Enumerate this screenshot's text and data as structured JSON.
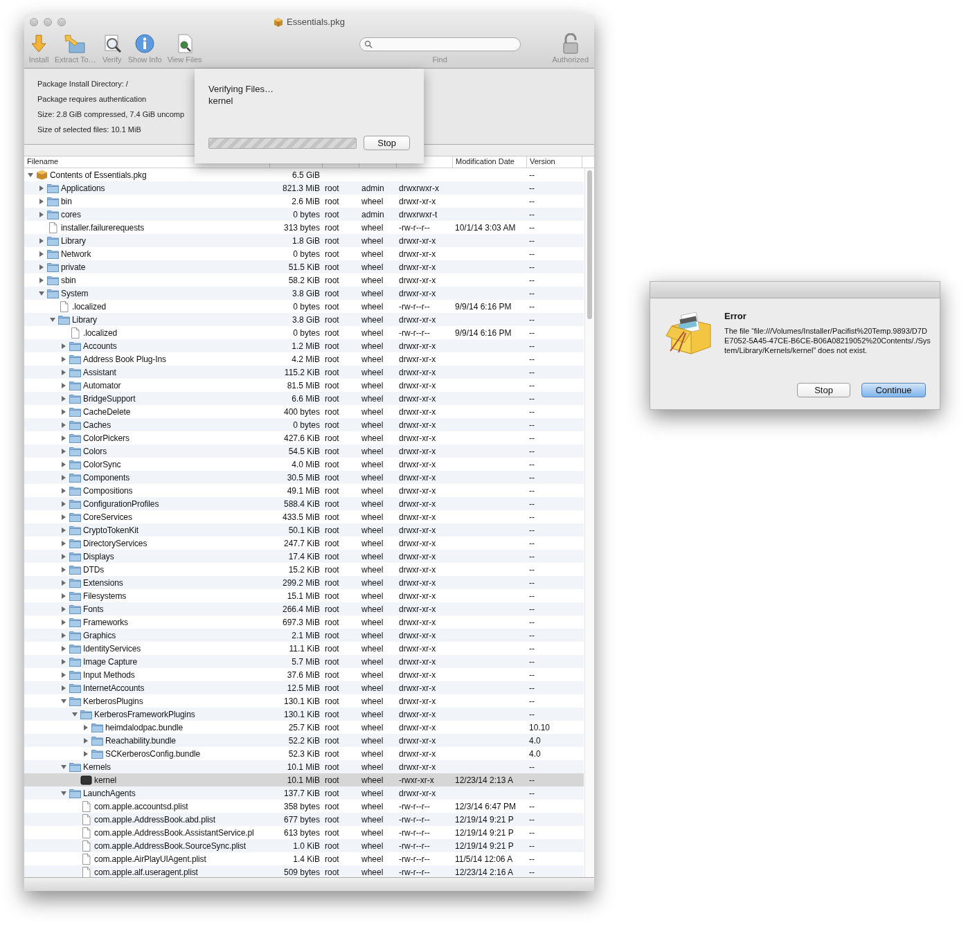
{
  "window": {
    "title": "Essentials.pkg"
  },
  "toolbar": {
    "buttons": [
      {
        "label": "Install",
        "kind": "install"
      },
      {
        "label": "Extract To…",
        "kind": "extract"
      },
      {
        "label": "Verify",
        "kind": "verify"
      },
      {
        "label": "Show Info",
        "kind": "info"
      },
      {
        "label": "View Files",
        "kind": "view-files"
      }
    ],
    "search": {
      "label": "Find"
    },
    "lock": {
      "label": "Authorized"
    }
  },
  "info": [
    "Package Install Directory: /",
    "Package requires authentication",
    "Size: 2.8 GiB compressed, 7.4 GiB uncomp",
    "Size of selected files: 10.1 MiB"
  ],
  "progress_sheet": {
    "title": "Verifying Files…",
    "file": "kernel",
    "button": "Stop",
    "indeterminate": true
  },
  "table": {
    "header": {
      "filename": "Filename",
      "modification_date": "Modification Date",
      "version": "Version"
    },
    "rows": [
      {
        "name": "Contents of Essentials.pkg",
        "kind": "package",
        "size": "6.5 GiB",
        "version": "--",
        "selected": false,
        "expanded": true,
        "children": [
          {
            "name": "Applications",
            "kind": "folder",
            "size": "821.3 MiB",
            "owner": "root",
            "group": "admin",
            "permissions": "drwxrwxr-x",
            "version": "--",
            "selected": false,
            "expanded": false
          },
          {
            "name": "bin",
            "kind": "folder",
            "size": "2.6 MiB",
            "owner": "root",
            "group": "wheel",
            "permissions": "drwxr-xr-x",
            "version": "--",
            "selected": false,
            "expanded": false
          },
          {
            "name": "cores",
            "kind": "folder",
            "size": "0 bytes",
            "owner": "root",
            "group": "admin",
            "permissions": "drwxrwxr-t",
            "version": "--",
            "selected": false,
            "expanded": false
          },
          {
            "name": "installer.failurerequests",
            "kind": "file",
            "size": "313 bytes",
            "owner": "root",
            "group": "wheel",
            "permissions": "-rw-r--r--",
            "modified": "10/1/14 3:03 AM",
            "version": "--",
            "selected": false
          },
          {
            "name": "Library",
            "kind": "folder",
            "size": "1.8 GiB",
            "owner": "root",
            "group": "wheel",
            "permissions": "drwxr-xr-x",
            "version": "--",
            "selected": false,
            "expanded": false
          },
          {
            "name": "Network",
            "kind": "folder",
            "size": "0 bytes",
            "owner": "root",
            "group": "wheel",
            "permissions": "drwxr-xr-x",
            "version": "--",
            "selected": false,
            "expanded": false
          },
          {
            "name": "private",
            "kind": "folder",
            "size": "51.5 KiB",
            "owner": "root",
            "group": "wheel",
            "permissions": "drwxr-xr-x",
            "version": "--",
            "selected": false,
            "expanded": false
          },
          {
            "name": "sbin",
            "kind": "folder",
            "size": "58.2 KiB",
            "owner": "root",
            "group": "wheel",
            "permissions": "drwxr-xr-x",
            "version": "--",
            "selected": false,
            "expanded": false
          },
          {
            "name": "System",
            "kind": "folder",
            "size": "3.8 GiB",
            "owner": "root",
            "group": "wheel",
            "permissions": "drwxr-xr-x",
            "version": "--",
            "selected": false,
            "expanded": true,
            "children": [
              {
                "name": ".localized",
                "kind": "file",
                "size": "0 bytes",
                "owner": "root",
                "group": "wheel",
                "permissions": "-rw-r--r--",
                "modified": "9/9/14 6:16 PM",
                "version": "--",
                "selected": false
              },
              {
                "name": "Library",
                "kind": "folder",
                "size": "3.8 GiB",
                "owner": "root",
                "group": "wheel",
                "permissions": "drwxr-xr-x",
                "version": "--",
                "selected": false,
                "expanded": true,
                "children": [
                  {
                    "name": ".localized",
                    "kind": "file",
                    "size": "0 bytes",
                    "owner": "root",
                    "group": "wheel",
                    "permissions": "-rw-r--r--",
                    "modified": "9/9/14 6:16 PM",
                    "version": "--",
                    "selected": false
                  },
                  {
                    "name": "Accounts",
                    "kind": "folder",
                    "size": "1.2 MiB",
                    "owner": "root",
                    "group": "wheel",
                    "permissions": "drwxr-xr-x",
                    "version": "--",
                    "selected": false,
                    "expanded": false
                  },
                  {
                    "name": "Address Book Plug-Ins",
                    "kind": "folder",
                    "size": "4.2 MiB",
                    "owner": "root",
                    "group": "wheel",
                    "permissions": "drwxr-xr-x",
                    "version": "--",
                    "selected": false,
                    "expanded": false
                  },
                  {
                    "name": "Assistant",
                    "kind": "folder",
                    "size": "115.2 KiB",
                    "owner": "root",
                    "group": "wheel",
                    "permissions": "drwxr-xr-x",
                    "version": "--",
                    "selected": false,
                    "expanded": false
                  },
                  {
                    "name": "Automator",
                    "kind": "folder",
                    "size": "81.5 MiB",
                    "owner": "root",
                    "group": "wheel",
                    "permissions": "drwxr-xr-x",
                    "version": "--",
                    "selected": false,
                    "expanded": false
                  },
                  {
                    "name": "BridgeSupport",
                    "kind": "folder",
                    "size": "6.6 MiB",
                    "owner": "root",
                    "group": "wheel",
                    "permissions": "drwxr-xr-x",
                    "version": "--",
                    "selected": false,
                    "expanded": false
                  },
                  {
                    "name": "CacheDelete",
                    "kind": "folder",
                    "size": "400 bytes",
                    "owner": "root",
                    "group": "wheel",
                    "permissions": "drwxr-xr-x",
                    "version": "--",
                    "selected": false,
                    "expanded": false
                  },
                  {
                    "name": "Caches",
                    "kind": "folder",
                    "size": "0 bytes",
                    "owner": "root",
                    "group": "wheel",
                    "permissions": "drwxr-xr-x",
                    "version": "--",
                    "selected": false,
                    "expanded": false
                  },
                  {
                    "name": "ColorPickers",
                    "kind": "folder",
                    "size": "427.6 KiB",
                    "owner": "root",
                    "group": "wheel",
                    "permissions": "drwxr-xr-x",
                    "version": "--",
                    "selected": false,
                    "expanded": false
                  },
                  {
                    "name": "Colors",
                    "kind": "folder",
                    "size": "54.5 KiB",
                    "owner": "root",
                    "group": "wheel",
                    "permissions": "drwxr-xr-x",
                    "version": "--",
                    "selected": false,
                    "expanded": false
                  },
                  {
                    "name": "ColorSync",
                    "kind": "folder",
                    "size": "4.0 MiB",
                    "owner": "root",
                    "group": "wheel",
                    "permissions": "drwxr-xr-x",
                    "version": "--",
                    "selected": false,
                    "expanded": false
                  },
                  {
                    "name": "Components",
                    "kind": "folder",
                    "size": "30.5 MiB",
                    "owner": "root",
                    "group": "wheel",
                    "permissions": "drwxr-xr-x",
                    "version": "--",
                    "selected": false,
                    "expanded": false
                  },
                  {
                    "name": "Compositions",
                    "kind": "folder",
                    "size": "49.1 MiB",
                    "owner": "root",
                    "group": "wheel",
                    "permissions": "drwxr-xr-x",
                    "version": "--",
                    "selected": false,
                    "expanded": false
                  },
                  {
                    "name": "ConfigurationProfiles",
                    "kind": "folder",
                    "size": "588.4 KiB",
                    "owner": "root",
                    "group": "wheel",
                    "permissions": "drwxr-xr-x",
                    "version": "--",
                    "selected": false,
                    "expanded": false
                  },
                  {
                    "name": "CoreServices",
                    "kind": "folder",
                    "size": "433.5 MiB",
                    "owner": "root",
                    "group": "wheel",
                    "permissions": "drwxr-xr-x",
                    "version": "--",
                    "selected": false,
                    "expanded": false
                  },
                  {
                    "name": "CryptoTokenKit",
                    "kind": "folder",
                    "size": "50.1 KiB",
                    "owner": "root",
                    "group": "wheel",
                    "permissions": "drwxr-xr-x",
                    "version": "--",
                    "selected": false,
                    "expanded": false
                  },
                  {
                    "name": "DirectoryServices",
                    "kind": "folder",
                    "size": "247.7 KiB",
                    "owner": "root",
                    "group": "wheel",
                    "permissions": "drwxr-xr-x",
                    "version": "--",
                    "selected": false,
                    "expanded": false
                  },
                  {
                    "name": "Displays",
                    "kind": "folder",
                    "size": "17.4 KiB",
                    "owner": "root",
                    "group": "wheel",
                    "permissions": "drwxr-xr-x",
                    "version": "--",
                    "selected": false,
                    "expanded": false
                  },
                  {
                    "name": "DTDs",
                    "kind": "folder",
                    "size": "15.2 KiB",
                    "owner": "root",
                    "group": "wheel",
                    "permissions": "drwxr-xr-x",
                    "version": "--",
                    "selected": false,
                    "expanded": false
                  },
                  {
                    "name": "Extensions",
                    "kind": "folder",
                    "size": "299.2 MiB",
                    "owner": "root",
                    "group": "wheel",
                    "permissions": "drwxr-xr-x",
                    "version": "--",
                    "selected": false,
                    "expanded": false
                  },
                  {
                    "name": "Filesystems",
                    "kind": "folder",
                    "size": "15.1 MiB",
                    "owner": "root",
                    "group": "wheel",
                    "permissions": "drwxr-xr-x",
                    "version": "--",
                    "selected": false,
                    "expanded": false
                  },
                  {
                    "name": "Fonts",
                    "kind": "folder",
                    "size": "266.4 MiB",
                    "owner": "root",
                    "group": "wheel",
                    "permissions": "drwxr-xr-x",
                    "version": "--",
                    "selected": false,
                    "expanded": false
                  },
                  {
                    "name": "Frameworks",
                    "kind": "folder",
                    "size": "697.3 MiB",
                    "owner": "root",
                    "group": "wheel",
                    "permissions": "drwxr-xr-x",
                    "version": "--",
                    "selected": false,
                    "expanded": false
                  },
                  {
                    "name": "Graphics",
                    "kind": "folder",
                    "size": "2.1 MiB",
                    "owner": "root",
                    "group": "wheel",
                    "permissions": "drwxr-xr-x",
                    "version": "--",
                    "selected": false,
                    "expanded": false
                  },
                  {
                    "name": "IdentityServices",
                    "kind": "folder",
                    "size": "11.1 KiB",
                    "owner": "root",
                    "group": "wheel",
                    "permissions": "drwxr-xr-x",
                    "version": "--",
                    "selected": false,
                    "expanded": false
                  },
                  {
                    "name": "Image Capture",
                    "kind": "folder",
                    "size": "5.7 MiB",
                    "owner": "root",
                    "group": "wheel",
                    "permissions": "drwxr-xr-x",
                    "version": "--",
                    "selected": false,
                    "expanded": false
                  },
                  {
                    "name": "Input Methods",
                    "kind": "folder",
                    "size": "37.6 MiB",
                    "owner": "root",
                    "group": "wheel",
                    "permissions": "drwxr-xr-x",
                    "version": "--",
                    "selected": false,
                    "expanded": false
                  },
                  {
                    "name": "InternetAccounts",
                    "kind": "folder",
                    "size": "12.5 MiB",
                    "owner": "root",
                    "group": "wheel",
                    "permissions": "drwxr-xr-x",
                    "version": "--",
                    "selected": false,
                    "expanded": false
                  },
                  {
                    "name": "KerberosPlugins",
                    "kind": "folder",
                    "size": "130.1 KiB",
                    "owner": "root",
                    "group": "wheel",
                    "permissions": "drwxr-xr-x",
                    "version": "--",
                    "selected": false,
                    "expanded": true,
                    "children": [
                      {
                        "name": "KerberosFrameworkPlugins",
                        "kind": "folder",
                        "size": "130.1 KiB",
                        "owner": "root",
                        "group": "wheel",
                        "permissions": "drwxr-xr-x",
                        "version": "--",
                        "selected": false,
                        "expanded": true,
                        "children": [
                          {
                            "name": "heimdalodpac.bundle",
                            "kind": "folder",
                            "size": "25.7 KiB",
                            "owner": "root",
                            "group": "wheel",
                            "permissions": "drwxr-xr-x",
                            "version": "10.10",
                            "selected": false,
                            "expanded": false
                          },
                          {
                            "name": "Reachability.bundle",
                            "kind": "folder",
                            "size": "52.2 KiB",
                            "owner": "root",
                            "group": "wheel",
                            "permissions": "drwxr-xr-x",
                            "version": "4.0",
                            "selected": false,
                            "expanded": false
                          },
                          {
                            "name": "SCKerberosConfig.bundle",
                            "kind": "folder",
                            "size": "52.3 KiB",
                            "owner": "root",
                            "group": "wheel",
                            "permissions": "drwxr-xr-x",
                            "version": "4.0",
                            "selected": false,
                            "expanded": false
                          }
                        ]
                      }
                    ]
                  },
                  {
                    "name": "Kernels",
                    "kind": "folder",
                    "size": "10.1 MiB",
                    "owner": "root",
                    "group": "wheel",
                    "permissions": "drwxr-xr-x",
                    "version": "--",
                    "selected": false,
                    "expanded": true,
                    "children": [
                      {
                        "name": "kernel",
                        "kind": "executable",
                        "size": "10.1 MiB",
                        "owner": "root",
                        "group": "wheel",
                        "permissions": "-rwxr-xr-x",
                        "modified": "12/23/14 2:13 A",
                        "version": "--",
                        "selected": true
                      }
                    ]
                  },
                  {
                    "name": "LaunchAgents",
                    "kind": "folder",
                    "size": "137.7 KiB",
                    "owner": "root",
                    "group": "wheel",
                    "permissions": "drwxr-xr-x",
                    "version": "--",
                    "selected": false,
                    "expanded": true,
                    "children": [
                      {
                        "name": "com.apple.accountsd.plist",
                        "kind": "file",
                        "size": "358 bytes",
                        "owner": "root",
                        "group": "wheel",
                        "permissions": "-rw-r--r--",
                        "modified": "12/3/14 6:47 PM",
                        "version": "--",
                        "selected": false
                      },
                      {
                        "name": "com.apple.AddressBook.abd.plist",
                        "kind": "file",
                        "size": "677 bytes",
                        "owner": "root",
                        "group": "wheel",
                        "permissions": "-rw-r--r--",
                        "modified": "12/19/14 9:21 P",
                        "version": "--",
                        "selected": false
                      },
                      {
                        "name": "com.apple.AddressBook.AssistantService.pl",
                        "kind": "file",
                        "size": "613 bytes",
                        "owner": "root",
                        "group": "wheel",
                        "permissions": "-rw-r--r--",
                        "modified": "12/19/14 9:21 P",
                        "version": "--",
                        "selected": false
                      },
                      {
                        "name": "com.apple.AddressBook.SourceSync.plist",
                        "kind": "file",
                        "size": "1.0 KiB",
                        "owner": "root",
                        "group": "wheel",
                        "permissions": "-rw-r--r--",
                        "modified": "12/19/14 9:21 P",
                        "version": "--",
                        "selected": false
                      },
                      {
                        "name": "com.apple.AirPlayUIAgent.plist",
                        "kind": "file",
                        "size": "1.4 KiB",
                        "owner": "root",
                        "group": "wheel",
                        "permissions": "-rw-r--r--",
                        "modified": "11/5/14 12:06 A",
                        "version": "--",
                        "selected": false
                      },
                      {
                        "name": "com.apple.alf.useragent.plist",
                        "kind": "file",
                        "size": "509 bytes",
                        "owner": "root",
                        "group": "wheel",
                        "permissions": "-rw-r--r--",
                        "modified": "12/23/14 2:16 A",
                        "version": "--",
                        "selected": false
                      }
                    ]
                  }
                ]
              }
            ]
          }
        ]
      }
    ]
  },
  "error_dialog": {
    "title": "Error",
    "message": "The file “file:///Volumes/Installer/Pacifist%20Temp.9893/D7DE7052-5A45-47CE-B6CE-B06A08219052%20Contents/./System/Library/Kernels/kernel” does not exist.",
    "buttons": [
      {
        "label": "Stop",
        "default": false
      },
      {
        "label": "Continue",
        "default": true
      }
    ]
  }
}
